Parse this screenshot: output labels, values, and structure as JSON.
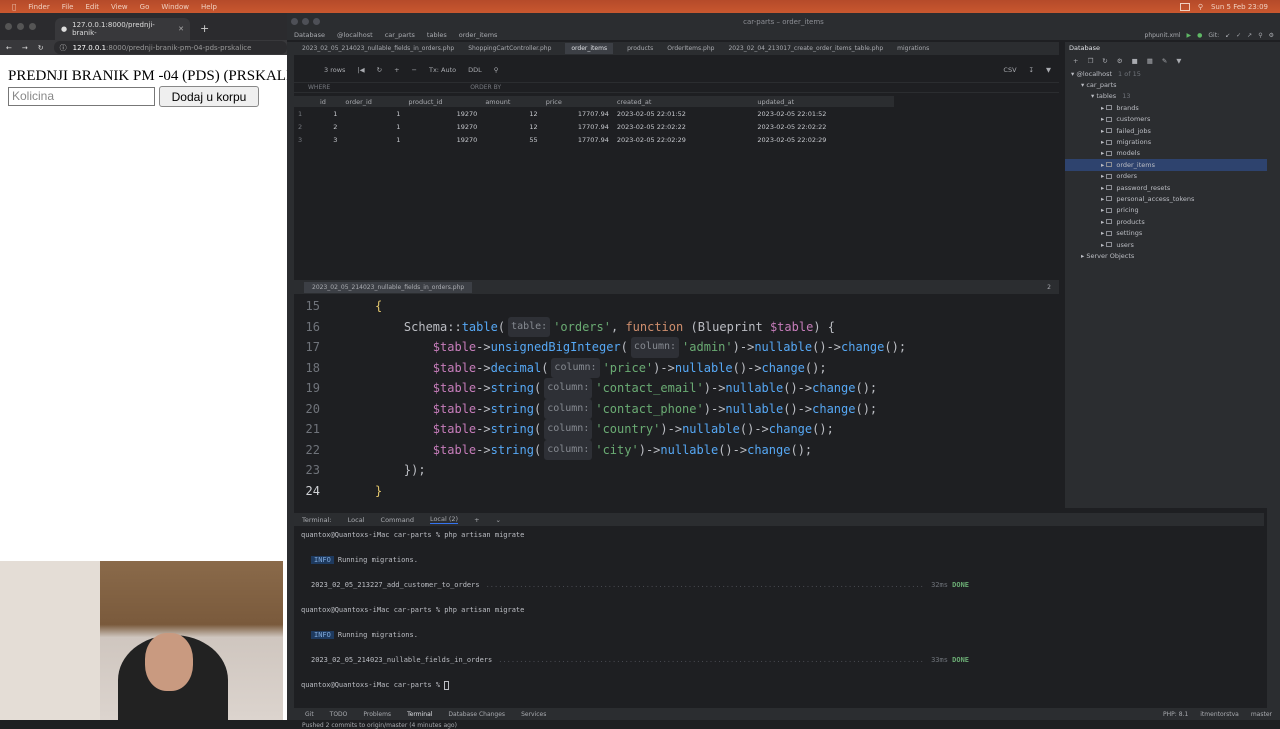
{
  "menubar": {
    "items": [
      "Finder",
      "File",
      "Edit",
      "View",
      "Go",
      "Window",
      "Help"
    ],
    "clock": "Sun 5 Feb  23:09"
  },
  "browser": {
    "tab_title": "127.0.0.1:8000/prednji-branik-",
    "url_host": "127.0.0.1",
    "url_path": ":8000/prednji-branik-pm-04-pds-prskalice",
    "page_title": "PREDNJI BRANIK PM -04 (PDS) (PRSKALICE)",
    "qty_placeholder": "Kolicina",
    "add_button": "Dodaj u korpu"
  },
  "ide": {
    "window_title": "car-parts – order_items",
    "breadcrumb": [
      "Database",
      "@localhost",
      "car_parts",
      "tables",
      "order_items"
    ],
    "run_config": "phpunit.xml",
    "git_label": "Git:",
    "editor_tabs": [
      "2023_02_05_214023_nullable_fields_in_orders.php",
      "ShoppingCartController.php",
      "order_items",
      "products",
      "OrderItems.php",
      "2023_02_04_213017_create_order_items_table.php",
      "migrations"
    ],
    "db_toolbar": {
      "rows": "3 rows",
      "tx": "Tx: Auto",
      "ddl": "DDL",
      "csv": "CSV"
    },
    "filter": {
      "where": "WHERE",
      "order_by": "ORDER BY"
    },
    "grid": {
      "columns": [
        "id",
        "order_id",
        "product_id",
        "amount",
        "price",
        "created_at",
        "updated_at"
      ],
      "rows": [
        [
          "1",
          "1",
          "1",
          "19270",
          "12",
          "17707.94",
          "2023-02-05 22:01:52",
          "2023-02-05 22:01:52"
        ],
        [
          "2",
          "2",
          "1",
          "19270",
          "12",
          "17707.94",
          "2023-02-05 22:02:22",
          "2023-02-05 22:02:22"
        ],
        [
          "3",
          "3",
          "1",
          "19270",
          "55",
          "17707.94",
          "2023-02-05 22:02:29",
          "2023-02-05 22:02:29"
        ]
      ]
    },
    "editor_file": "2023_02_05_214023_nullable_fields_in_orders.php",
    "code": {
      "l15": "15",
      "l16": "16",
      "l17": "17",
      "l18": "18",
      "l19": "19",
      "l20": "20",
      "l21": "21",
      "l22": "22",
      "l23": "23",
      "l24": "24",
      "schema": "Schema::",
      "table_fn": "table",
      "hint_table": "table:",
      "orders": "'orders'",
      "function_kw": "function",
      "blueprint": "(Blueprint",
      "var_table": "$table",
      "open_rest": ") {",
      "c17_fn": "unsignedBigInteger",
      "c17_val": "'admin'",
      "c18_fn": "decimal",
      "c18_val": "'price'",
      "c19_fn": "string",
      "c19_val": "'contact_email'",
      "c20_fn": "string",
      "c20_val": "'contact_phone'",
      "c21_fn": "string",
      "c21_val": "'country'",
      "c22_fn": "string",
      "c22_val": "'city'",
      "hint_column": "column:",
      "arrow": "->",
      "nullable": "nullable",
      "change": "change",
      "tail": "();",
      "close_fn": "});",
      "open_brace": "{",
      "close_brace": "}",
      "warnings": "2"
    },
    "terminal_tabs": [
      "Terminal:",
      "Local",
      "Command",
      "Local (2)"
    ],
    "terminal": {
      "prompt1": "quantox@Quantoxs-iMac car-parts % php artisan migrate",
      "info": "INFO",
      "running": "Running migrations.",
      "mig1": "2023_02_05_213227_add_customer_to_orders",
      "mig1_ms": "32ms",
      "done": "DONE",
      "prompt2": "quantox@Quantoxs-iMac car-parts % php artisan migrate",
      "mig2": "2023_02_05_214023_nullable_fields_in_orders",
      "mig2_ms": "33ms",
      "prompt3": "quantox@Quantoxs-iMac car-parts % "
    },
    "db_panel": {
      "title": "Database",
      "host": "@localhost",
      "host_count": "1 of 15",
      "schema": "car_parts",
      "tables_label": "tables",
      "tables_count": "13",
      "tables": [
        "brands",
        "customers",
        "failed_jobs",
        "migrations",
        "models",
        "order_items",
        "orders",
        "password_resets",
        "personal_access_tokens",
        "pricing",
        "products",
        "settings",
        "users"
      ],
      "selected": "order_items",
      "server_objects": "Server Objects"
    },
    "status_tabs": [
      "Git",
      "TODO",
      "Problems",
      "Terminal",
      "Database Changes",
      "Services"
    ],
    "status_right": [
      "PHP: 8.1",
      "itmentorstva",
      "master"
    ],
    "pushed": "Pushed 2 commits to origin/master (4 minutes ago)"
  }
}
